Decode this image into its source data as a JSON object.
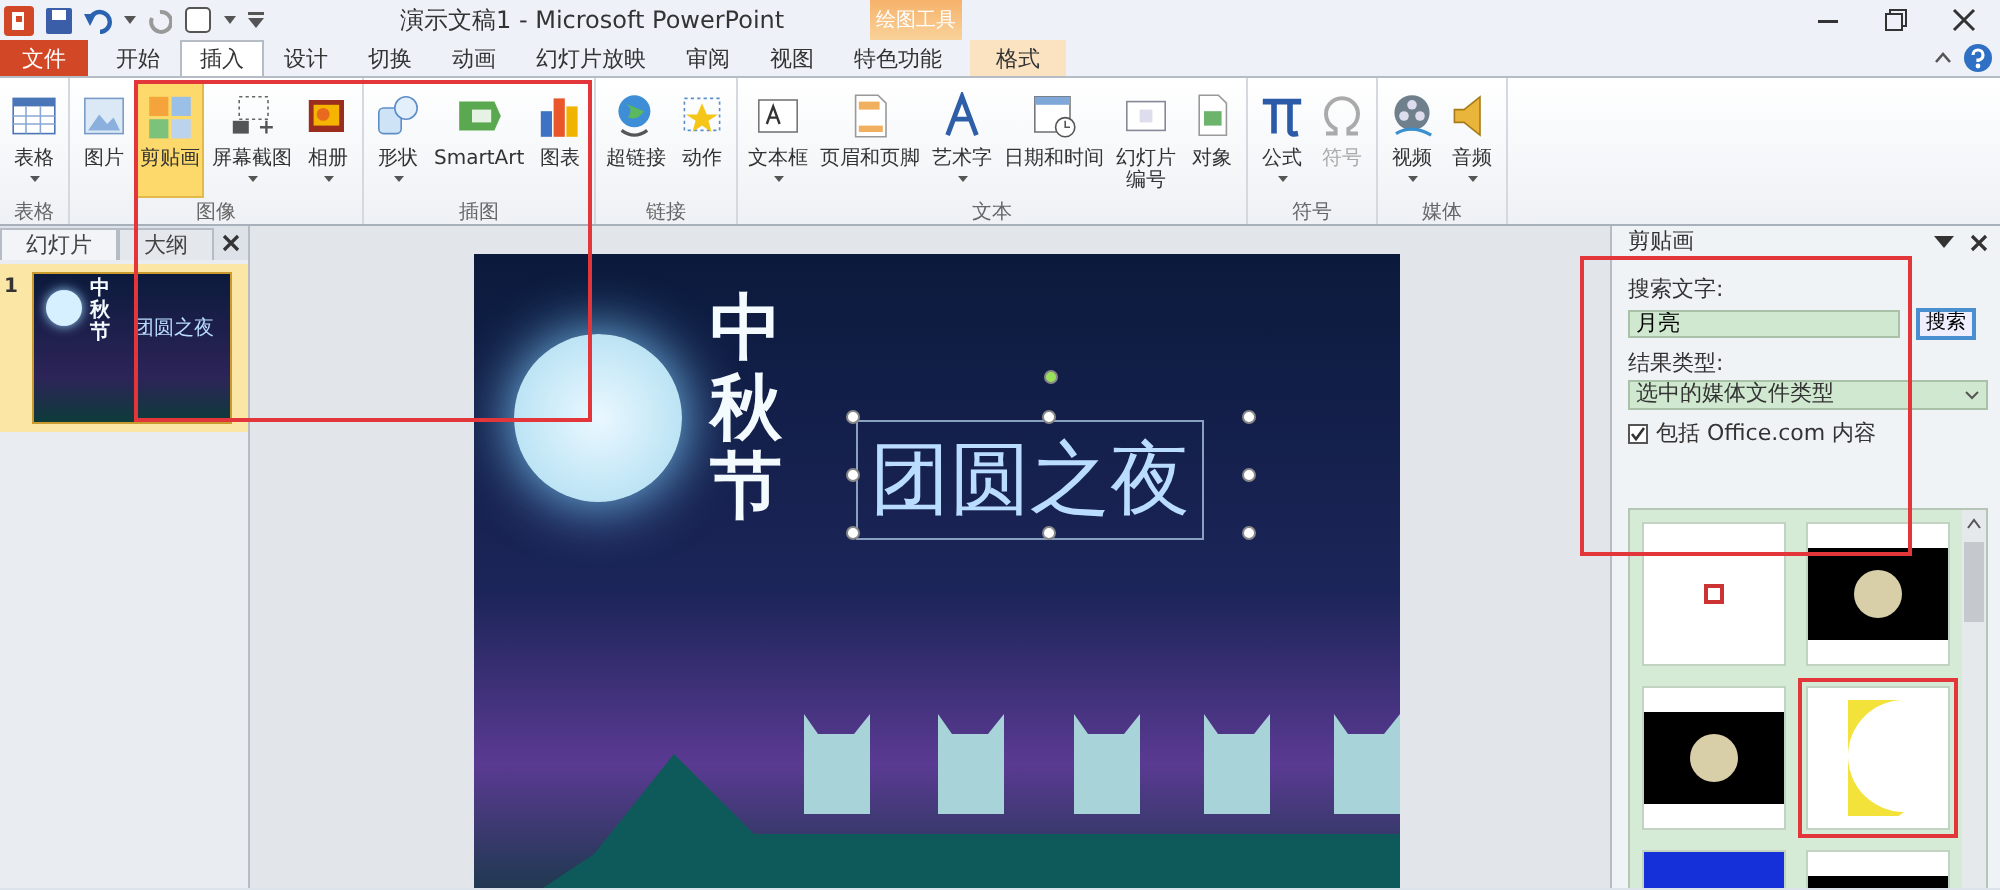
{
  "window": {
    "title": "演示文稿1 - Microsoft PowerPoint"
  },
  "contextual_tab_group": "绘图工具",
  "tabs": [
    {
      "label": "文件",
      "kind": "file",
      "selected": false
    },
    {
      "label": "开始",
      "kind": "normal",
      "selected": false
    },
    {
      "label": "插入",
      "kind": "normal",
      "selected": true
    },
    {
      "label": "设计",
      "kind": "normal",
      "selected": false
    },
    {
      "label": "切换",
      "kind": "normal",
      "selected": false
    },
    {
      "label": "动画",
      "kind": "normal",
      "selected": false
    },
    {
      "label": "幻灯片放映",
      "kind": "normal",
      "selected": false
    },
    {
      "label": "审阅",
      "kind": "normal",
      "selected": false
    },
    {
      "label": "视图",
      "kind": "normal",
      "selected": false
    },
    {
      "label": "特色功能",
      "kind": "normal",
      "selected": false
    },
    {
      "label": "格式",
      "kind": "contextual",
      "selected": false
    }
  ],
  "ribbon_groups": [
    {
      "label": "表格",
      "buttons": [
        {
          "label": "表格",
          "dropdown": true,
          "selected": false,
          "disabled": false
        }
      ]
    },
    {
      "label": "图像",
      "buttons": [
        {
          "label": "图片",
          "dropdown": false,
          "selected": false,
          "disabled": false
        },
        {
          "label": "剪贴画",
          "dropdown": false,
          "selected": true,
          "disabled": false
        },
        {
          "label": "屏幕截图",
          "dropdown": true,
          "selected": false,
          "disabled": false
        },
        {
          "label": "相册",
          "dropdown": true,
          "selected": false,
          "disabled": false
        }
      ]
    },
    {
      "label": "插图",
      "buttons": [
        {
          "label": "形状",
          "dropdown": true,
          "selected": false,
          "disabled": false
        },
        {
          "label": "SmartArt",
          "dropdown": false,
          "selected": false,
          "disabled": false
        },
        {
          "label": "图表",
          "dropdown": false,
          "selected": false,
          "disabled": false
        }
      ]
    },
    {
      "label": "链接",
      "buttons": [
        {
          "label": "超链接",
          "dropdown": false,
          "selected": false,
          "disabled": false
        },
        {
          "label": "动作",
          "dropdown": false,
          "selected": false,
          "disabled": false
        }
      ]
    },
    {
      "label": "文本",
      "buttons": [
        {
          "label": "文本框",
          "dropdown": true,
          "selected": false,
          "disabled": false
        },
        {
          "label": "页眉和页脚",
          "dropdown": false,
          "selected": false,
          "disabled": false
        },
        {
          "label": "艺术字",
          "dropdown": true,
          "selected": false,
          "disabled": false
        },
        {
          "label": "日期和时间",
          "dropdown": false,
          "selected": false,
          "disabled": false
        },
        {
          "label_lines": [
            "幻灯片",
            "编号"
          ],
          "dropdown": false,
          "selected": false,
          "disabled": false
        },
        {
          "label": "对象",
          "dropdown": false,
          "selected": false,
          "disabled": false
        }
      ]
    },
    {
      "label": "符号",
      "buttons": [
        {
          "label": "公式",
          "dropdown": true,
          "selected": false,
          "disabled": false
        },
        {
          "label": "符号",
          "dropdown": false,
          "selected": false,
          "disabled": true
        }
      ]
    },
    {
      "label": "媒体",
      "buttons": [
        {
          "label": "视频",
          "dropdown": true,
          "selected": false,
          "disabled": false
        },
        {
          "label": "音频",
          "dropdown": true,
          "selected": false,
          "disabled": false
        }
      ]
    }
  ],
  "slides_pane": {
    "tabs": [
      {
        "label": "幻灯片",
        "selected": true
      },
      {
        "label": "大纲",
        "selected": false
      }
    ],
    "slides": [
      {
        "number": "1",
        "selected": true,
        "vertical_title": "中秋节",
        "title": "团圆之夜"
      }
    ]
  },
  "slide": {
    "vertical_title": "中秋节",
    "title": "团圆之夜",
    "title_selected": true
  },
  "clip_art_pane": {
    "title": "剪贴画",
    "search_label": "搜索文字:",
    "search_value": "月亮",
    "search_button": "搜索",
    "result_type_label": "结果类型:",
    "result_type_value": "选中的媒体文件类型",
    "include_office": {
      "label": "包括 Office.com 内容",
      "checked": true
    },
    "results": [
      {
        "kind": "clipart"
      },
      {
        "kind": "photo"
      },
      {
        "kind": "photo"
      },
      {
        "kind": "crescent"
      },
      {
        "kind": "cartoon"
      },
      {
        "kind": "photo"
      }
    ]
  }
}
